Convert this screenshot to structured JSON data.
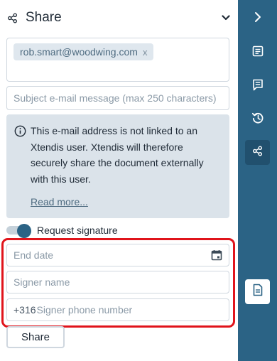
{
  "header": {
    "title": "Share",
    "share_icon": "share-icon",
    "collapse_icon": "chevron-down-icon"
  },
  "recipients": {
    "chips": [
      {
        "email": "rob.smart@woodwing.com",
        "remove_label": "x"
      }
    ]
  },
  "subject": {
    "value": "",
    "placeholder": "Subject e-mail message (max 250 characters)"
  },
  "notice": {
    "icon": "info-icon",
    "text": "This e-mail address is not linked to an Xtendis user. Xtendis will therefore securely share the document externally with this user.",
    "link_label": "Read more..."
  },
  "signature_toggle": {
    "label": "Request signature",
    "on": true
  },
  "end_date": {
    "value": "",
    "placeholder": "End date",
    "icon": "calendar-icon"
  },
  "signer_name": {
    "value": "",
    "placeholder": "Signer name"
  },
  "signer_phone": {
    "prefix": "+316",
    "value": "",
    "placeholder": "Signer phone number"
  },
  "actions": {
    "share_label": "Share"
  },
  "rail": {
    "items": [
      {
        "icon": "chevron-right-icon",
        "active": false
      },
      {
        "icon": "document-details-icon",
        "active": false
      },
      {
        "icon": "comment-icon",
        "active": false
      },
      {
        "icon": "history-icon",
        "active": false
      },
      {
        "icon": "share-icon",
        "active": true
      },
      {
        "icon": "document-icon",
        "active": false
      }
    ]
  },
  "colors": {
    "accent": "#2b6385",
    "highlight": "#e0141b",
    "notice_bg": "#dbe3ea",
    "chip_bg": "#dfe7ee"
  }
}
